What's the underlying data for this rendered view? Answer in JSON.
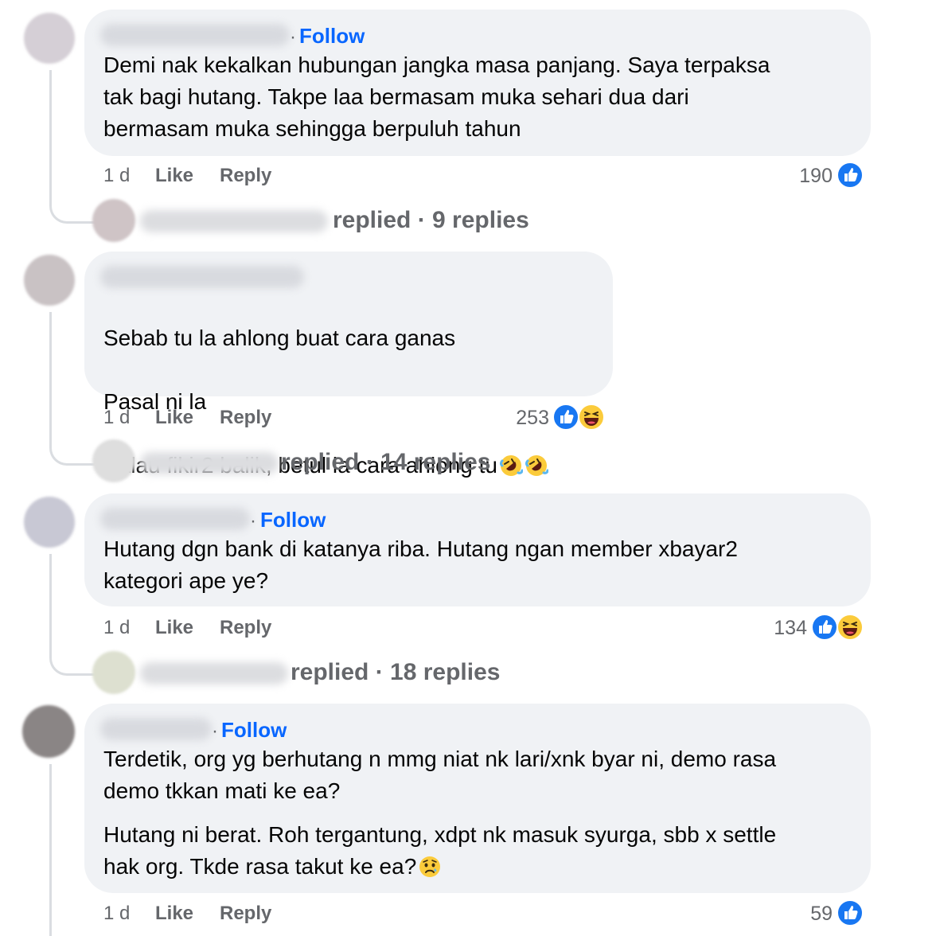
{
  "colors": {
    "bubble": "#f0f2f5",
    "link_blue": "#0866ff",
    "meta_gray": "#65676b",
    "text": "#050505"
  },
  "comments": [
    {
      "follow_label": "Follow",
      "body": "Demi nak kekalkan hubungan jangka masa panjang. Saya terpaksa\ntak bagi hutang. Takpe laa bermasam muka sehari dua dari\nbermasam muka sehingga berpuluh tahun",
      "time": "1 d",
      "like_label": "Like",
      "reply_label": "Reply",
      "reaction_count": "190",
      "reactions": [
        "like-icon"
      ],
      "replies_summary": "replied · 9 replies"
    },
    {
      "follow_label": "",
      "lines": [
        "Sebab tu la ahlong buat cara ganas",
        "Pasal ni la",
        "Kalau fikir2 balik, betul la cara ahlong tu"
      ],
      "inline_emojis": [
        "rolling-laughing-emoji",
        "rolling-laughing-emoji"
      ],
      "time": "1 d",
      "like_label": "Like",
      "reply_label": "Reply",
      "reaction_count": "253",
      "reactions": [
        "like-icon",
        "haha-icon"
      ],
      "replies_summary": "replied · 14 replies"
    },
    {
      "follow_label": "Follow",
      "body": "Hutang dgn bank di katanya riba. Hutang ngan member xbayar2\nkategori ape ye?",
      "time": "1 d",
      "like_label": "Like",
      "reply_label": "Reply",
      "reaction_count": "134",
      "reactions": [
        "like-icon",
        "haha-icon"
      ],
      "replies_summary": "replied · 18 replies"
    },
    {
      "follow_label": "Follow",
      "body": "Terdetik, org yg berhutang n mmg niat nk lari/xnk byar ni, demo rasa\ndemo tkkan mati ke ea?",
      "body2": "Hutang ni berat. Roh tergantung, xdpt nk masuk syurga, sbb x settle\nhak org. Tkde rasa takut ke ea?",
      "inline_emojis": [
        "sad-face-emoji"
      ],
      "time": "1 d",
      "like_label": "Like",
      "reply_label": "Reply",
      "reaction_count": "59",
      "reactions": [
        "like-icon"
      ]
    }
  ]
}
